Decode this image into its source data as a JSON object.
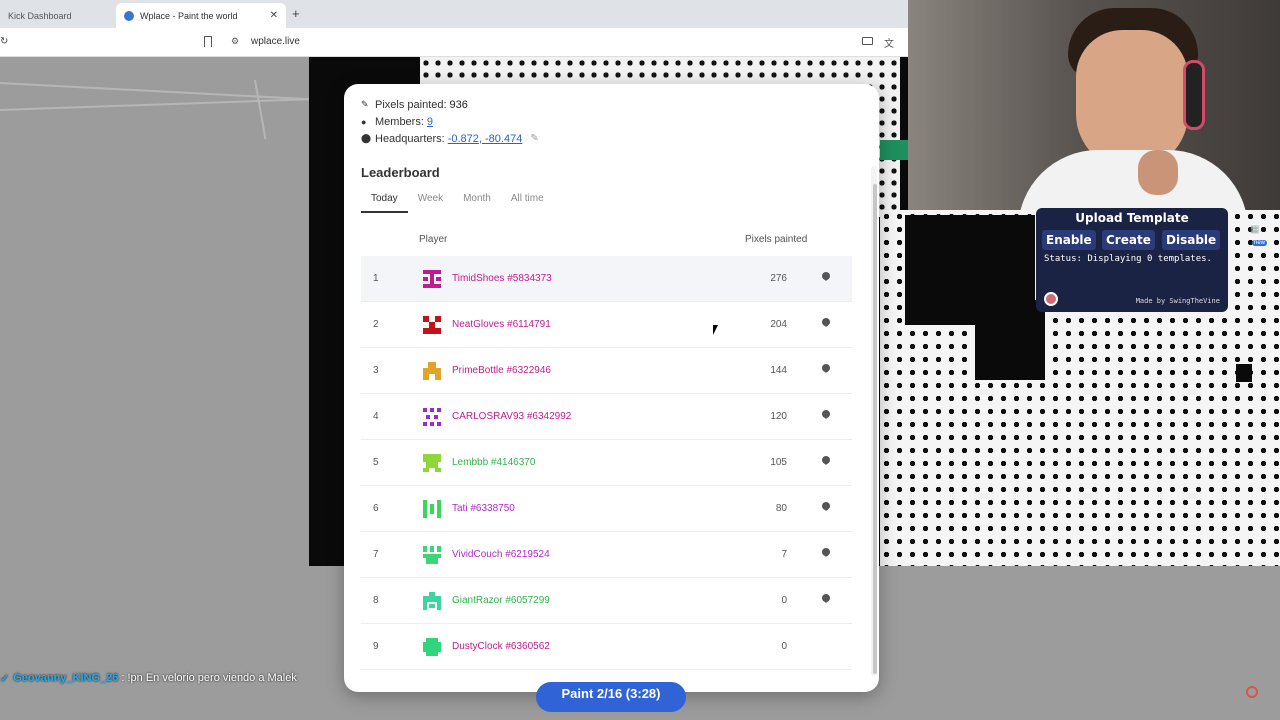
{
  "browser": {
    "tabs": [
      {
        "label": "Kick Dashboard"
      },
      {
        "label": "Wplace - Paint the world"
      }
    ],
    "url": "wplace.live"
  },
  "stats": {
    "pixels_painted_label": "Pixels painted:",
    "pixels_painted_value": "936",
    "members_label": "Members:",
    "members_value": "9",
    "headquarters_label": "Headquarters:",
    "headquarters_value": "-0.872, -80.474"
  },
  "leaderboard": {
    "title": "Leaderboard",
    "tabs": [
      "Today",
      "Week",
      "Month",
      "All time"
    ],
    "col_player": "Player",
    "col_pixels": "Pixels painted",
    "rows": [
      {
        "rank": "1",
        "name": "TimidShoes #5834373",
        "pixels": "276",
        "color": "#c21b8f"
      },
      {
        "rank": "2",
        "name": "NeatGloves #6114791",
        "pixels": "204",
        "color": "#c21b8f"
      },
      {
        "rank": "3",
        "name": "PrimeBottle #6322946",
        "pixels": "144",
        "color": "#c21b8f"
      },
      {
        "rank": "4",
        "name": "CARLOSRAV93 #6342992",
        "pixels": "120",
        "color": "#c21b8f"
      },
      {
        "rank": "5",
        "name": "Lembbb #4146370",
        "pixels": "105",
        "color": "#2fb34a"
      },
      {
        "rank": "6",
        "name": "Tati #6338750",
        "pixels": "80",
        "color": "#b02ac9"
      },
      {
        "rank": "7",
        "name": "VividCouch #6219524",
        "pixels": "7",
        "color": "#b02ac9"
      },
      {
        "rank": "8",
        "name": "GiantRazor #6057299",
        "pixels": "0",
        "color": "#2fb34a"
      },
      {
        "rank": "9",
        "name": "DustyClock #6360562",
        "pixels": "0",
        "color": "#c21b8f"
      }
    ]
  },
  "template_widget": {
    "title": "Upload Template",
    "enable_label": "Enable",
    "create_label": "Create",
    "disable_label": "Disable",
    "status": "Status: Displaying 0 templates.",
    "credit": "Made by SwingTheVine"
  },
  "paint_button": {
    "label": "Paint 2/16 (3:28)"
  },
  "chat": {
    "user": "Geovanny_KING_26",
    "message": ": !pn En velorio pero viendo a Malek"
  },
  "colors": {
    "link": "#2a63c8",
    "widget_bg": "#1a2344",
    "paint_button": "#2f63d6"
  }
}
